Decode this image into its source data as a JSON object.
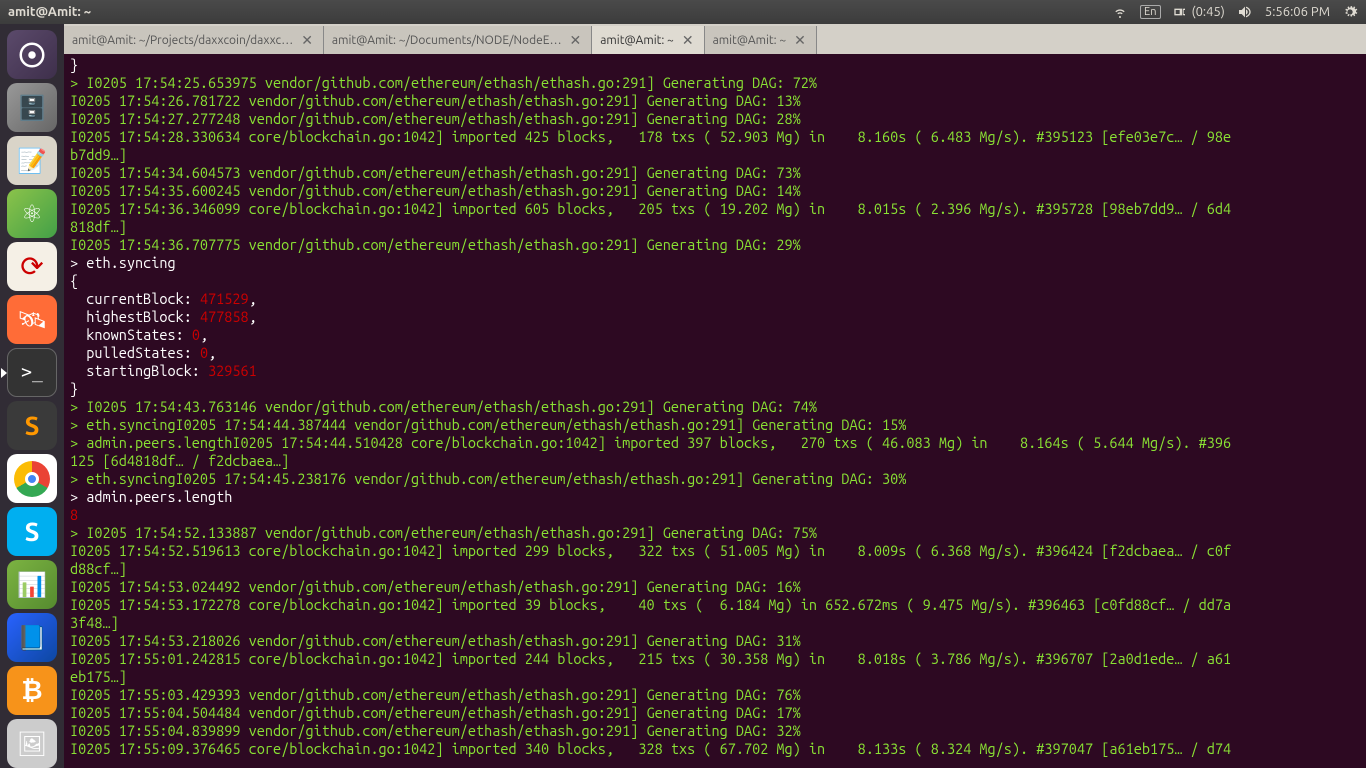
{
  "topbar": {
    "title": "amit@Amit: ~",
    "lang": "En",
    "battery": "(0:45)",
    "time": "5:56:06 PM"
  },
  "tabs": [
    {
      "title": "amit@Amit: ~/Projects/daxxcoin/daxxc…",
      "active": false
    },
    {
      "title": "amit@Amit: ~/Documents/NODE/NodeE…",
      "active": false
    },
    {
      "title": "amit@Amit: ~",
      "active": true
    },
    {
      "title": "amit@Amit: ~",
      "active": false
    }
  ],
  "syncing": {
    "cmd": "eth.syncing",
    "currentBlock_label": "currentBlock:",
    "currentBlock": "471529",
    "highestBlock_label": "highestBlock:",
    "highestBlock": "477858",
    "knownStates_label": "knownStates:",
    "knownStates": "0",
    "pulledStates_label": "pulledStates:",
    "pulledStates": "0",
    "startingBlock_label": "startingBlock:",
    "startingBlock": "329561"
  },
  "peers_cmd": "admin.peers.length",
  "peers_val": "8",
  "lines": {
    "l0": "}",
    "l1": "> I0205 17:54:25.653975 vendor/github.com/ethereum/ethash/ethash.go:291] Generating DAG: 72%",
    "l2": "I0205 17:54:26.781722 vendor/github.com/ethereum/ethash/ethash.go:291] Generating DAG: 13%",
    "l3": "I0205 17:54:27.277248 vendor/github.com/ethereum/ethash/ethash.go:291] Generating DAG: 28%",
    "l4": "I0205 17:54:28.330634 core/blockchain.go:1042] imported 425 blocks,   178 txs ( 52.903 Mg) in    8.160s ( 6.483 Mg/s). #395123 [efe03e7c… / 98e",
    "l5": "b7dd9…]",
    "l6": "I0205 17:54:34.604573 vendor/github.com/ethereum/ethash/ethash.go:291] Generating DAG: 73%",
    "l7": "I0205 17:54:35.600245 vendor/github.com/ethereum/ethash/ethash.go:291] Generating DAG: 14%",
    "l8": "I0205 17:54:36.346099 core/blockchain.go:1042] imported 605 blocks,   205 txs ( 19.202 Mg) in    8.015s ( 2.396 Mg/s). #395728 [98eb7dd9… / 6d4",
    "l9": "818df…]",
    "l10": "I0205 17:54:36.707775 vendor/github.com/ethereum/ethash/ethash.go:291] Generating DAG: 29%",
    "l11": "}",
    "l12": "> I0205 17:54:43.763146 vendor/github.com/ethereum/ethash/ethash.go:291] Generating DAG: 74%",
    "l13": "> eth.syncingI0205 17:54:44.387444 vendor/github.com/ethereum/ethash/ethash.go:291] Generating DAG: 15%",
    "l14": "> admin.peers.lengthI0205 17:54:44.510428 core/blockchain.go:1042] imported 397 blocks,   270 txs ( 46.083 Mg) in    8.164s ( 5.644 Mg/s). #396",
    "l15": "125 [6d4818df… / f2dcbaea…]",
    "l16": "> eth.syncingI0205 17:54:45.238176 vendor/github.com/ethereum/ethash/ethash.go:291] Generating DAG: 30%",
    "l17": "> I0205 17:54:52.133887 vendor/github.com/ethereum/ethash/ethash.go:291] Generating DAG: 75%",
    "l18": "I0205 17:54:52.519613 core/blockchain.go:1042] imported 299 blocks,   322 txs ( 51.005 Mg) in    8.009s ( 6.368 Mg/s). #396424 [f2dcbaea… / c0f",
    "l19": "d88cf…]",
    "l20": "I0205 17:54:53.024492 vendor/github.com/ethereum/ethash/ethash.go:291] Generating DAG: 16%",
    "l21": "I0205 17:54:53.172278 core/blockchain.go:1042] imported 39 blocks,    40 txs (  6.184 Mg) in 652.672ms ( 9.475 Mg/s). #396463 [c0fd88cf… / dd7a",
    "l22": "3f48…]",
    "l23": "I0205 17:54:53.218026 vendor/github.com/ethereum/ethash/ethash.go:291] Generating DAG: 31%",
    "l24": "I0205 17:55:01.242815 core/blockchain.go:1042] imported 244 blocks,   215 txs ( 30.358 Mg) in    8.018s ( 3.786 Mg/s). #396707 [2a0d1ede… / a61",
    "l25": "eb175…]",
    "l26": "I0205 17:55:03.429393 vendor/github.com/ethereum/ethash/ethash.go:291] Generating DAG: 76%",
    "l27": "I0205 17:55:04.504484 vendor/github.com/ethereum/ethash/ethash.go:291] Generating DAG: 17%",
    "l28": "I0205 17:55:04.839899 vendor/github.com/ethereum/ethash/ethash.go:291] Generating DAG: 32%",
    "l29": "I0205 17:55:09.376465 core/blockchain.go:1042] imported 340 blocks,   328 txs ( 67.702 Mg) in    8.133s ( 8.324 Mg/s). #397047 [a61eb175… / d74"
  }
}
